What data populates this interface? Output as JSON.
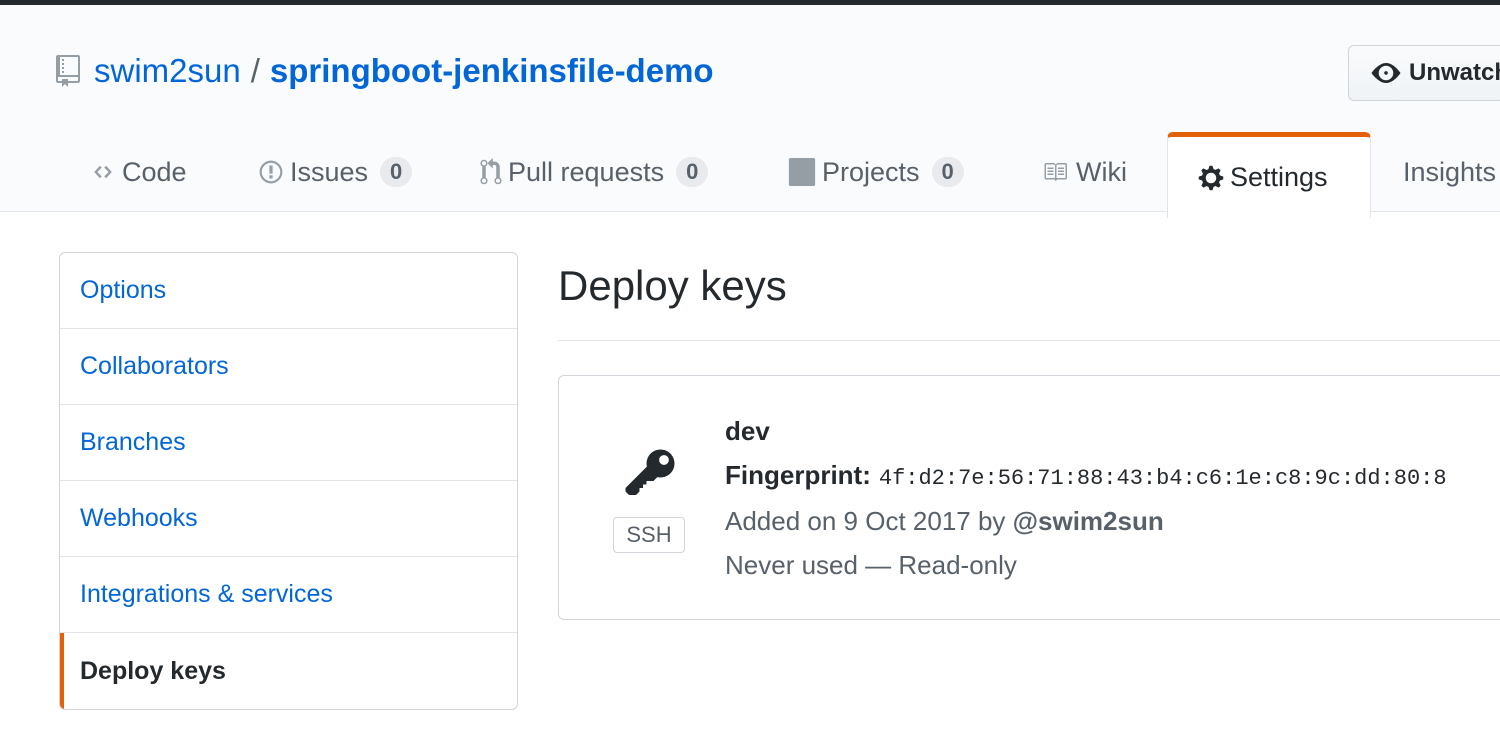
{
  "repo": {
    "owner": "swim2sun",
    "separator": "/",
    "name": "springboot-jenkinsfile-demo",
    "watch_label": "Unwatch"
  },
  "tabs": [
    {
      "label": "Code",
      "icon": "code-icon"
    },
    {
      "label": "Issues",
      "icon": "issue-opened-icon",
      "count": "0"
    },
    {
      "label": "Pull requests",
      "icon": "git-pull-request-icon",
      "count": "0"
    },
    {
      "label": "Projects",
      "icon": "project-icon",
      "count": "0"
    },
    {
      "label": "Wiki",
      "icon": "book-icon"
    },
    {
      "label": "Settings",
      "icon": "gear-icon",
      "selected": true
    },
    {
      "label": "Insights",
      "icon": "graph-icon"
    }
  ],
  "sidebar": {
    "items": [
      {
        "label": "Options"
      },
      {
        "label": "Collaborators"
      },
      {
        "label": "Branches"
      },
      {
        "label": "Webhooks"
      },
      {
        "label": "Integrations & services"
      },
      {
        "label": "Deploy keys",
        "active": true
      }
    ]
  },
  "main": {
    "title": "Deploy keys",
    "key": {
      "name": "dev",
      "type_badge": "SSH",
      "fingerprint_label": "Fingerprint:",
      "fingerprint": "4f:d2:7e:56:71:88:43:b4:c6:1e:c8:9c:dd:80:8",
      "added_text": "Added on 9 Oct 2017 by",
      "added_by": "@swim2sun",
      "usage": "Never used — Read-only"
    }
  },
  "colors": {
    "link": "#0366d6",
    "accent": "#e36209",
    "text": "#24292e",
    "muted": "#586069"
  }
}
